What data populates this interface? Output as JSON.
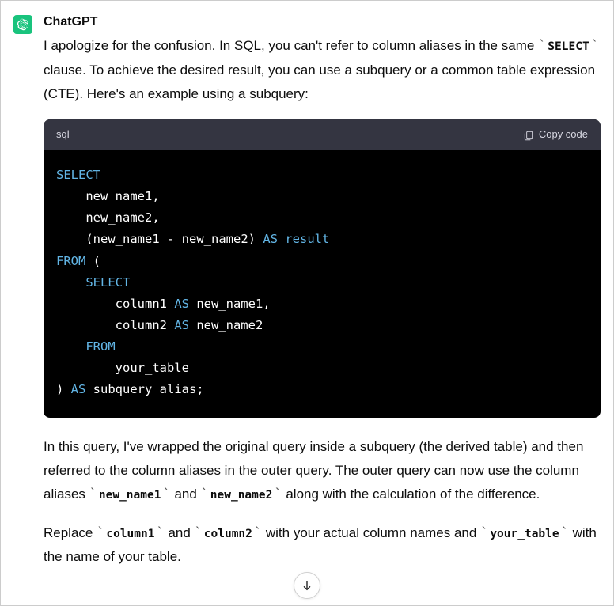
{
  "author": "ChatGPT",
  "para1_a": "I apologize for the confusion. In SQL, you can't refer to column aliases in the same ",
  "para1_code": "SELECT",
  "para1_b": " clause. To achieve the desired result, you can use a subquery or a common table expression (CTE). Here's an example using a subquery:",
  "code_lang": "sql",
  "copy_label": "Copy code",
  "code_tokens": [
    [
      {
        "t": "SELECT",
        "c": "kw"
      }
    ],
    [
      {
        "t": "    new_name1,",
        "c": "id"
      }
    ],
    [
      {
        "t": "    new_name2,",
        "c": "id"
      }
    ],
    [
      {
        "t": "    (new_name1 ",
        "c": "id"
      },
      {
        "t": "-",
        "c": "op"
      },
      {
        "t": " new_name2) ",
        "c": "id"
      },
      {
        "t": "AS",
        "c": "kw"
      },
      {
        "t": " ",
        "c": "id"
      },
      {
        "t": "result",
        "c": "kw"
      }
    ],
    [
      {
        "t": "FROM",
        "c": "kw"
      },
      {
        "t": " (",
        "c": "id"
      }
    ],
    [
      {
        "t": "    ",
        "c": "id"
      },
      {
        "t": "SELECT",
        "c": "kw"
      }
    ],
    [
      {
        "t": "        column1 ",
        "c": "id"
      },
      {
        "t": "AS",
        "c": "kw"
      },
      {
        "t": " new_name1,",
        "c": "id"
      }
    ],
    [
      {
        "t": "        column2 ",
        "c": "id"
      },
      {
        "t": "AS",
        "c": "kw"
      },
      {
        "t": " new_name2",
        "c": "id"
      }
    ],
    [
      {
        "t": "    ",
        "c": "id"
      },
      {
        "t": "FROM",
        "c": "kw"
      }
    ],
    [
      {
        "t": "        your_table",
        "c": "id"
      }
    ],
    [
      {
        "t": ") ",
        "c": "id"
      },
      {
        "t": "AS",
        "c": "kw"
      },
      {
        "t": " subquery_alias;",
        "c": "id"
      }
    ]
  ],
  "para2_a": "In this query, I've wrapped the original query inside a subquery (the derived table) and then referred to the column aliases in the outer query. The outer query can now use the column aliases ",
  "para2_code1": "new_name1",
  "para2_mid": " and ",
  "para2_code2": "new_name2",
  "para2_b": " along with the calculation of the difference.",
  "para3_a": "Replace ",
  "para3_code1": "column1",
  "para3_mid1": " and ",
  "para3_code2": "column2",
  "para3_mid2": " with your actual column names and ",
  "para3_code3": "your_table",
  "para3_b": " with the name of your table."
}
